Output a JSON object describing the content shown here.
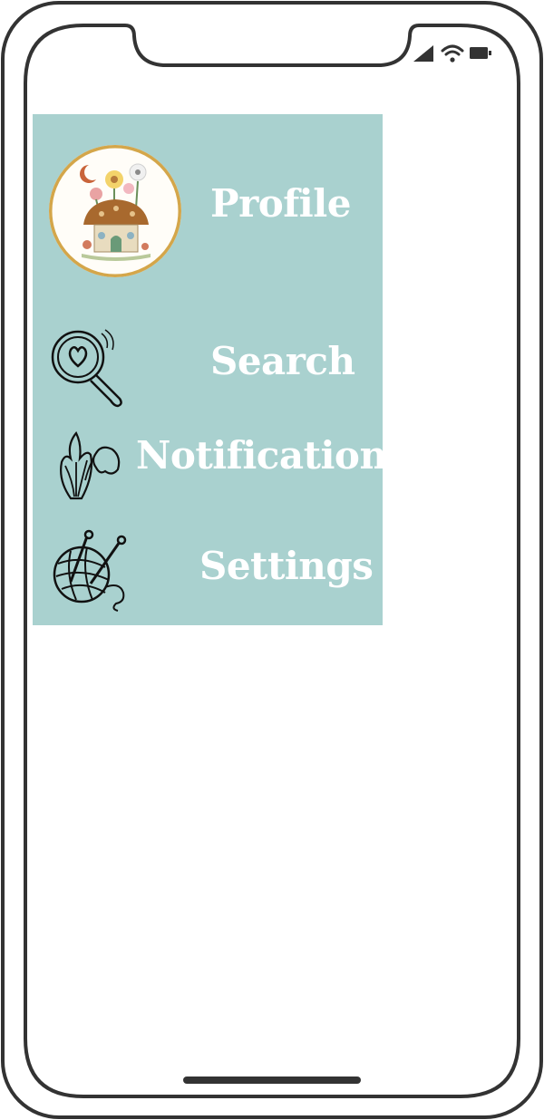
{
  "menu": {
    "profile_label": "Profile",
    "search_label": "Search",
    "notifications_label": "Notifications",
    "settings_label": "Settings"
  },
  "icons": {
    "avatar": "mushroom-house-avatar",
    "search": "magnifier-heart-icon",
    "notifications": "tulip-flower-icon",
    "settings": "yarn-ball-knitting-icon"
  },
  "colors": {
    "panel": "#a9d1cf",
    "label": "#ffffff",
    "frame": "#333333",
    "avatar_ring": "#d4a64a"
  }
}
